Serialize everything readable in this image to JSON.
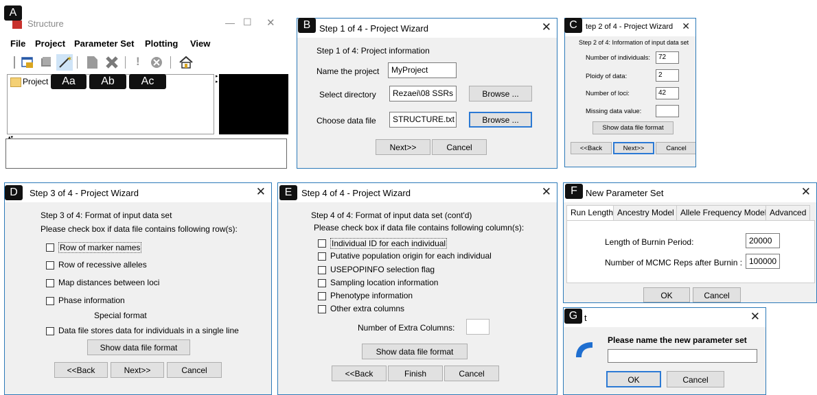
{
  "labels": {
    "A": "A",
    "B": "B",
    "C": "C",
    "D": "D",
    "E": "E",
    "F": "F",
    "G": "G",
    "Aa": "Aa",
    "Ab": "Ab",
    "Ac": "Ac"
  },
  "a": {
    "title": "Structure",
    "win_controls": [
      "—",
      "☐",
      "✕"
    ],
    "menu": [
      "File",
      "Project",
      "Parameter Set",
      "Plotting",
      "View"
    ],
    "tree_item": "Project"
  },
  "b": {
    "title": "Step 1 of 4 - Project Wizard",
    "heading": "Step 1 of 4: Project information",
    "name_label": "Name the project",
    "name_value": "MyProject",
    "dir_label": "Select directory",
    "dir_value": "Rezaei\\08 SSRs",
    "file_label": "Choose data file",
    "file_value": "STRUCTURE.txt",
    "browse": "Browse ...",
    "next": "Next>>",
    "cancel": "Cancel"
  },
  "c": {
    "title": "tep 2 of 4 - Project Wizard",
    "heading": "Step 2 of 4: Information of input data set",
    "individuals_label": "Number of individuals:",
    "individuals_value": "72",
    "ploidy_label": "Ploidy of data:",
    "ploidy_value": "2",
    "loci_label": "Number of loci:",
    "loci_value": "42",
    "missing_label": "Missing data value:",
    "missing_value": "",
    "show_format": "Show data file format",
    "back": "<<Back",
    "next": "Next>>",
    "cancel": "Cancel"
  },
  "d": {
    "title": "Step 3 of 4 - Project Wizard",
    "heading": "Step 3 of 4: Format of input data set",
    "subheading": "Please check box if data file contains following row(s):",
    "rows": [
      "Row of marker names",
      "Row of recessive alleles",
      "Map distances between loci",
      "Phase information"
    ],
    "special": "Special format",
    "single_line": "Data file stores data for individuals in a single line",
    "show_format": "Show data file format",
    "back": "<<Back",
    "next": "Next>>",
    "cancel": "Cancel"
  },
  "e": {
    "title": "Step 4 of 4 - Project Wizard",
    "heading": "Step 4 of 4: Format of input data set (cont'd)",
    "subheading": "Please check box if data file contains following column(s):",
    "columns": [
      "Individual ID for each individual",
      "Putative population origin for each individual",
      "USEPOPINFO selection flag",
      "Sampling location information",
      "Phenotype information",
      "Other extra columns"
    ],
    "extra_label": "Number of Extra Columns:",
    "extra_value": "",
    "show_format": "Show data file format",
    "back": "<<Back",
    "finish": "Finish",
    "cancel": "Cancel"
  },
  "f": {
    "title": "New Parameter Set",
    "tabs": [
      "Run Length",
      "Ancestry Model",
      "Allele Frequency Model",
      "Advanced"
    ],
    "burnin_label": "Length of Burnin Period:",
    "burnin_value": "20000",
    "mcmc_label": "Number of MCMC Reps after Burnin :",
    "mcmc_value": "100000",
    "ok": "OK",
    "cancel": "Cancel"
  },
  "g": {
    "title": "t",
    "prompt": "Please name the new parameter set",
    "input_value": "",
    "ok": "OK",
    "cancel": "Cancel"
  }
}
